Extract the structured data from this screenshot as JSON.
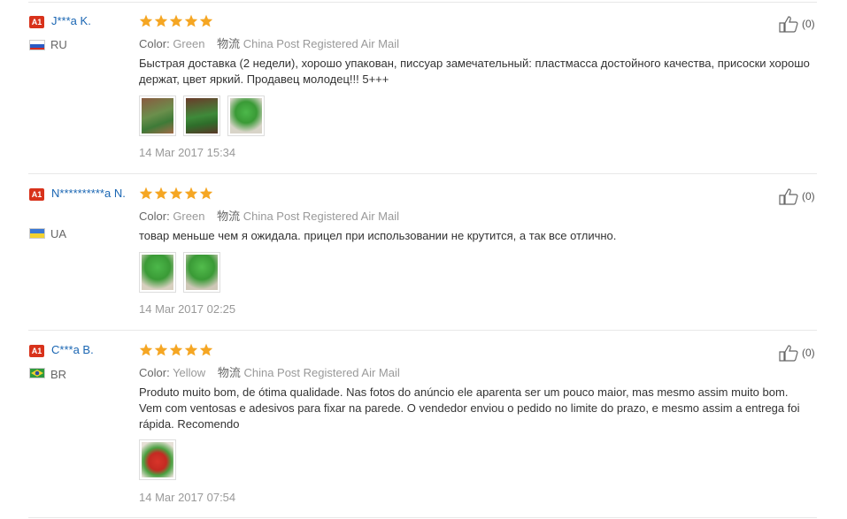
{
  "colors": {
    "star": "#f5a623",
    "badge": "#d8321b",
    "name": "#1a66b3"
  },
  "meta_labels": {
    "color_key": "Color:",
    "logistics_key": "物流"
  },
  "reviews": [
    {
      "badge": "A1",
      "name": "J***a K.",
      "country": "RU",
      "stars": 5,
      "color": "Green",
      "shipping": "China Post Registered Air Mail",
      "text": "Быстрая доставка (2 недели), хорошо упакован, писсуар замечательный: пластмасса достойного качества, присоски хорошо держат, цвет яркий. Продавец молодец!!! 5+++",
      "photos": 3,
      "date": "14 Mar 2017 15:34",
      "helpful": "(0)"
    },
    {
      "badge": "A1",
      "name": "N**********a N.",
      "country": "UA",
      "stars": 5,
      "color": "Green",
      "shipping": "China Post Registered Air Mail",
      "text": "товар меньше чем я ожидала. прицел при использовании не крутится, а так все отлично.",
      "photos": 2,
      "date": "14 Mar 2017 02:25",
      "helpful": "(0)"
    },
    {
      "badge": "A1",
      "name": "C***a B.",
      "country": "BR",
      "stars": 5,
      "color": "Yellow",
      "shipping": "China Post Registered Air Mail",
      "text": "Produto muito bom, de ótima qualidade. Nas fotos do anúncio ele aparenta ser um pouco maior, mas mesmo assim muito bom. Vem com ventosas e adesivos para fixar na parede. O vendedor enviou o pedido no limite do prazo, e mesmo assim a entrega foi rápida. Recomendo",
      "photos": 1,
      "date": "14 Mar 2017 07:54",
      "helpful": "(0)"
    }
  ]
}
